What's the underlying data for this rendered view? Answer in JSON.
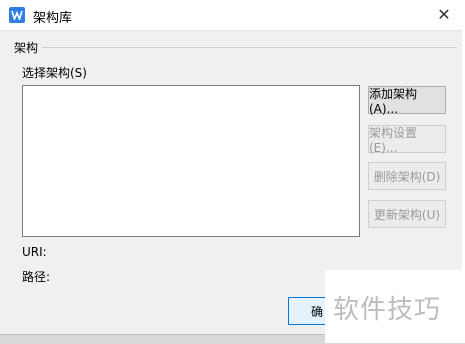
{
  "window": {
    "title": "架构库",
    "app_icon": "wps-w-icon",
    "close_glyph": "✕"
  },
  "section": {
    "label": "架构"
  },
  "list": {
    "label": "选择架构(S)",
    "items": []
  },
  "buttons": {
    "add": {
      "label": "添加架构(A)...",
      "enabled": true
    },
    "settings": {
      "label": "架构设置(E)...",
      "enabled": false
    },
    "delete": {
      "label": "删除架构(D)",
      "enabled": false
    },
    "update": {
      "label": "更新架构(U)",
      "enabled": false
    },
    "ok": {
      "label": "确"
    }
  },
  "info": {
    "uri_label": "URI:",
    "path_label": "路径:"
  },
  "watermark": {
    "text": "软件技巧"
  },
  "colors": {
    "accent": "#2f7fe0",
    "dialog_bg": "#f0f0f0",
    "disabled_text": "#9a9a9a",
    "focus_border": "#0078d7"
  }
}
